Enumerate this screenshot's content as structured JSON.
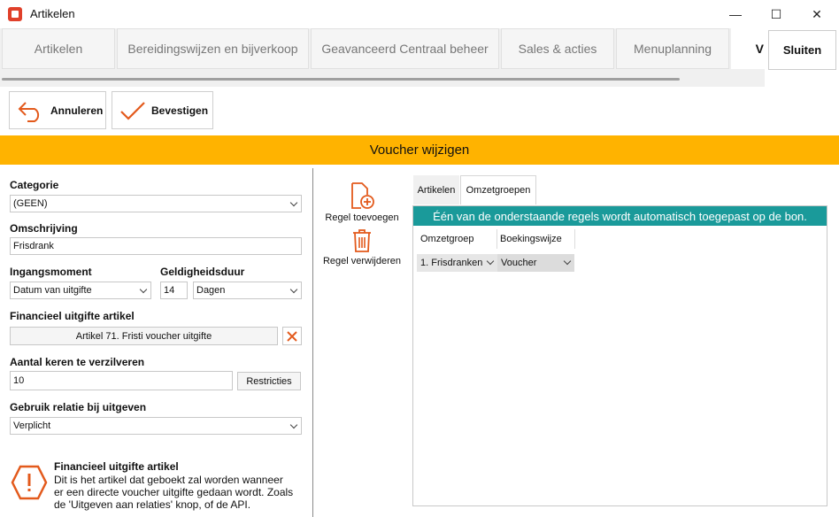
{
  "window": {
    "title": "Artikelen",
    "minimize_glyph": "—",
    "maximize_glyph": "☐",
    "close_glyph": "✕"
  },
  "tabs": [
    {
      "label": "Artikelen"
    },
    {
      "label": "Bereidingswijzen en bijverkoop"
    },
    {
      "label": "Geavanceerd Centraal beheer"
    },
    {
      "label": "Sales & acties"
    },
    {
      "label": "Menuplanning"
    },
    {
      "label": "V"
    }
  ],
  "close_button": "Sluiten",
  "toolbar": {
    "cancel_label": "Annuleren",
    "confirm_label": "Bevestigen"
  },
  "banner": "Voucher wijzigen",
  "form": {
    "categorie_label": "Categorie",
    "categorie_value": "(GEEN)",
    "omschrijving_label": "Omschrijving",
    "omschrijving_value": "Frisdrank",
    "ingangsmoment_label": "Ingangsmoment",
    "ingangsmoment_value": "Datum van uitgifte",
    "geldigheidsduur_label": "Geldigheidsduur",
    "geldigheidsduur_value": "14",
    "geldigheidsduur_unit": "Dagen",
    "financieel_label": "Financieel uitgifte artikel",
    "financieel_value": "Artikel 71. Fristi voucher uitgifte",
    "aantal_label": "Aantal keren te verzilveren",
    "aantal_value": "10",
    "restricties_label": "Restricties",
    "relatie_label": "Gebruik relatie bij uitgeven",
    "relatie_value": "Verplicht"
  },
  "info": {
    "title": "Financieel uitgifte artikel",
    "line1": "Dit is het artikel dat geboekt zal worden wanneer",
    "line2": "er een directe voucher uitgifte gedaan wordt. Zoals",
    "line3": "de 'Uitgeven aan relaties' knop, of de API."
  },
  "actions": {
    "add_label": "Regel toevoegen",
    "remove_label": "Regel verwijderen"
  },
  "subtabs": [
    {
      "label": "Artikelen"
    },
    {
      "label": "Omzetgroepen"
    }
  ],
  "grid": {
    "notice": "Één van de onderstaande regels wordt automatisch toegepast op de bon.",
    "columns": [
      "Omzetgroep",
      "Boekingswijze"
    ],
    "rows": [
      [
        "1. Frisdranken",
        "Voucher"
      ]
    ]
  },
  "colors": {
    "banner": "#ffb300",
    "accent": "#e35a1c",
    "grid_header": "#1a9a9a"
  }
}
